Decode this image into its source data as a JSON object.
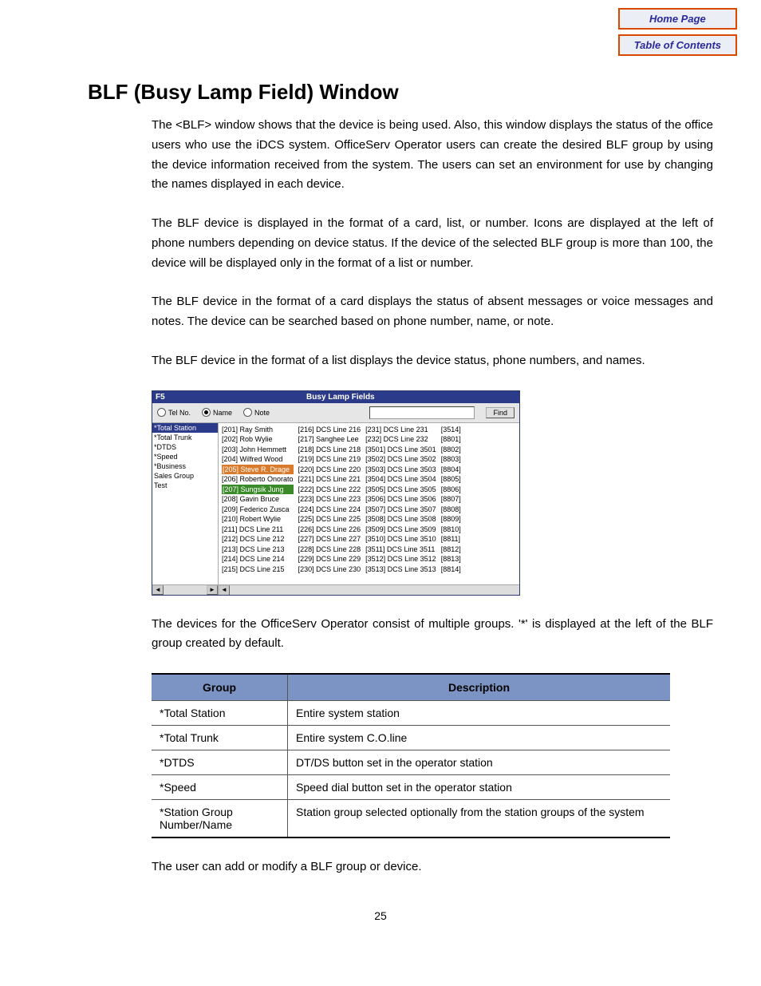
{
  "nav": {
    "home": "Home Page",
    "toc": "Table of Contents"
  },
  "title": "BLF (Busy Lamp Field) Window",
  "paragraphs": {
    "p1": "The <BLF> window shows that the device is being used. Also, this window displays the status of the office users who use the iDCS system. OfficeServ Operator users can create the desired BLF group by using the device information received from the system. The users can set an environment for use by changing the names displayed in each device.",
    "p2": "The BLF device is displayed in the format of a card, list, or number. Icons are displayed at the left of phone numbers depending on device status. If the device of the selected BLF group is more than 100, the device will be displayed only in the format of a list or number.",
    "p3": "The BLF device in the format of a card displays the status of absent messages or voice messages and notes. The device can be searched based on phone number, name, or note.",
    "p4": "The BLF device in the format of a list displays the device status, phone numbers, and names.",
    "p5": "The devices for the OfficeServ Operator consist of multiple groups. '*' is displayed at the left of the BLF group created by default.",
    "p6": "The user can add or modify a BLF group or device."
  },
  "screenshot": {
    "f5": "F5",
    "title": "Busy Lamp Fields",
    "radios": {
      "telno": "Tel No.",
      "name": "Name",
      "note": "Note"
    },
    "find": "Find",
    "sidebar": [
      "*Total Station",
      "*Total Trunk",
      "*DTDS",
      "*Speed",
      "*Business",
      "Sales Group",
      "Test"
    ],
    "col1": [
      "[201] Ray Smith",
      "[202] Rob Wylie",
      "[203] John Hemmett",
      "[204] Wilfred Wood",
      "[205] Steve R. Drage",
      "[206] Roberto Onorato",
      "[207] Sungsik Jung",
      "[208] Gavin Bruce",
      "[209] Federico Zusca",
      "[210] Robert Wylie",
      "[211] DCS Line 211",
      "[212] DCS Line 212",
      "[213] DCS Line 213",
      "[214] DCS Line 214",
      "[215] DCS Line 215"
    ],
    "col2": [
      "[216] DCS Line 216",
      "[217] Sanghee Lee",
      "[218] DCS Line 218",
      "[219] DCS Line 219",
      "[220] DCS Line 220",
      "[221] DCS Line 221",
      "[222] DCS Line 222",
      "[223] DCS Line 223",
      "[224] DCS Line 224",
      "[225] DCS Line 225",
      "[226] DCS Line 226",
      "[227] DCS Line 227",
      "[228] DCS Line 228",
      "[229] DCS Line 229",
      "[230] DCS Line 230"
    ],
    "col3": [
      "[231] DCS Line 231",
      "[232] DCS Line 232",
      "[3501] DCS Line 3501",
      "[3502] DCS Line 3502",
      "[3503] DCS Line 3503",
      "[3504] DCS Line 3504",
      "[3505] DCS Line 3505",
      "[3506] DCS Line 3506",
      "[3507] DCS Line 3507",
      "[3508] DCS Line 3508",
      "[3509] DCS Line 3509",
      "[3510] DCS Line 3510",
      "[3511] DCS Line 3511",
      "[3512] DCS Line 3512",
      "[3513] DCS Line 3513"
    ],
    "col4": [
      "[3514]",
      "[8801]",
      "[8802]",
      "[8803]",
      "[8804]",
      "[8805]",
      "[8806]",
      "[8807]",
      "[8808]",
      "[8809]",
      "[8810]",
      "[8811]",
      "[8812]",
      "[8813]",
      "[8814]"
    ]
  },
  "table": {
    "headers": {
      "group": "Group",
      "desc": "Description"
    },
    "rows": [
      {
        "group": "*Total Station",
        "desc": "Entire system station"
      },
      {
        "group": "*Total Trunk",
        "desc": "Entire system C.O.line"
      },
      {
        "group": "*DTDS",
        "desc": "DT/DS button set in the operator station"
      },
      {
        "group": "*Speed",
        "desc": "Speed dial button set in the operator station"
      },
      {
        "group": "*Station Group Number/Name",
        "desc": "Station group selected optionally from the station groups of the system"
      }
    ]
  },
  "page_number": "25"
}
